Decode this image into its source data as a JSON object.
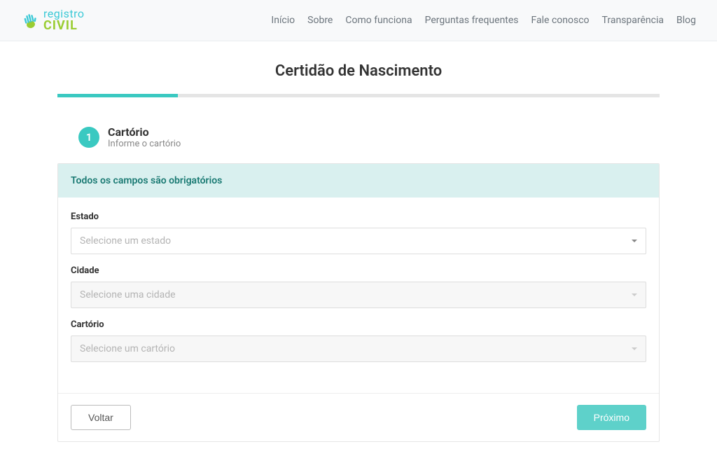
{
  "logo": {
    "top": "registro",
    "bottom": "CIVIL"
  },
  "nav": [
    "Início",
    "Sobre",
    "Como funciona",
    "Perguntas frequentes",
    "Fale conosco",
    "Transparência",
    "Blog"
  ],
  "page_title": "Certidão de Nascimento",
  "step": {
    "number": "1",
    "title": "Cartório",
    "subtitle": "Informe o cartório"
  },
  "notice": "Todos os campos são obrigatórios",
  "fields": {
    "estado": {
      "label": "Estado",
      "placeholder": "Selecione um estado"
    },
    "cidade": {
      "label": "Cidade",
      "placeholder": "Selecione uma cidade"
    },
    "cartorio": {
      "label": "Cartório",
      "placeholder": "Selecione um cartório"
    }
  },
  "buttons": {
    "back": "Voltar",
    "next": "Próximo"
  }
}
